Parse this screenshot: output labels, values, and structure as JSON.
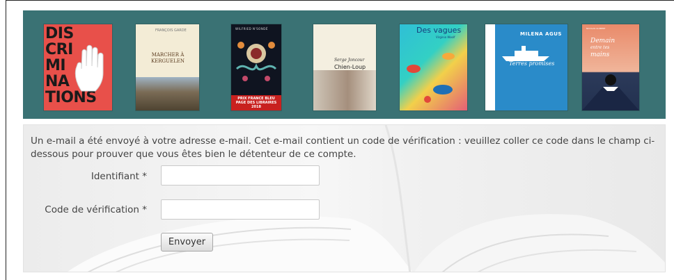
{
  "banner": {
    "books": [
      {
        "title_lines": [
          "DIS",
          "CRI",
          "MI",
          "NA",
          "TIONS"
        ]
      },
      {
        "author": "FRANÇOIS GARDE",
        "title": "MARCHER À KERGUELEN"
      },
      {
        "author": "WILFRIED N'SONDÉ",
        "band": [
          "PRIX FRANCE BLEU",
          "PAGE DES LIBRAIRES",
          "2018"
        ]
      },
      {
        "author": "Serge Joncour",
        "title": "Chien-Loup"
      },
      {
        "title": "Des vagues",
        "author": "Virginia Woolf"
      },
      {
        "author": "MILENA AGUS",
        "title": "Terres promises"
      },
      {
        "author": "NICOLAS GUIBERT",
        "title_lines": [
          "Demain",
          "entre tes",
          "mains"
        ]
      }
    ]
  },
  "form": {
    "message": "Un e-mail a été envoyé à votre adresse e-mail. Cet e-mail contient un code de vérification : veuillez coller ce code dans le champ ci-dessous pour prouver que vous êtes bien le détenteur de ce compte.",
    "identifier_label": "Identifiant *",
    "identifier_value": "",
    "code_label": "Code de vérification *",
    "code_value": "",
    "submit_label": "Envoyer"
  },
  "colors": {
    "banner_bg": "#3a7274",
    "panel_bg": "#f0f0f0",
    "text": "#444444"
  }
}
